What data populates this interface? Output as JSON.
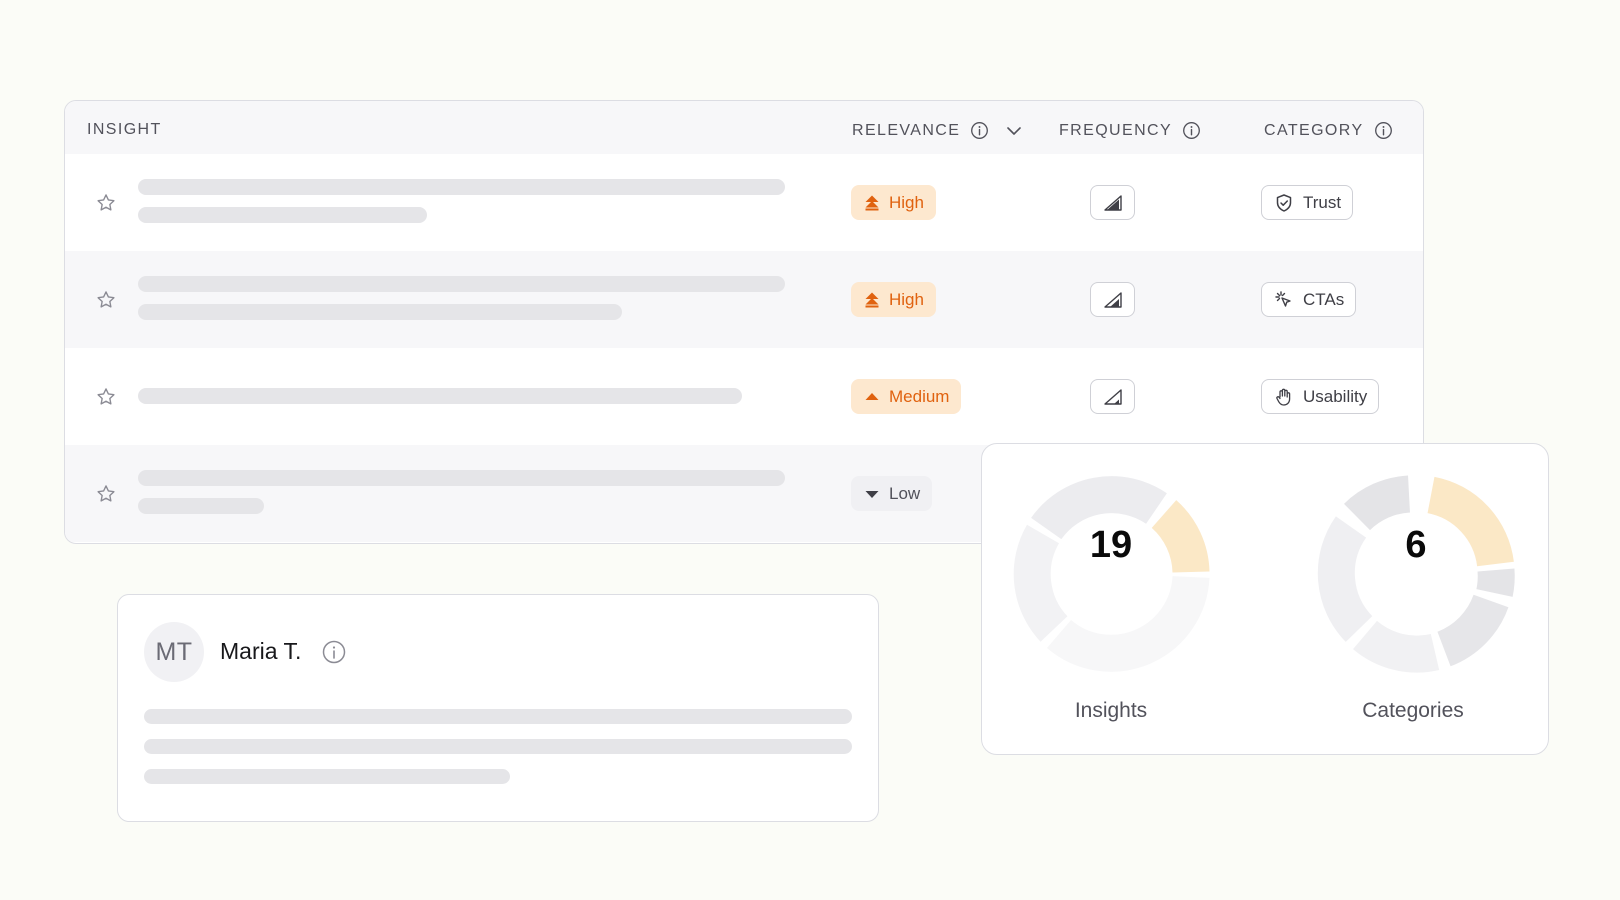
{
  "table": {
    "headers": {
      "insight": "INSIGHT",
      "relevance": "RELEVANCE",
      "frequency": "FREQUENCY",
      "category": "CATEGORY"
    },
    "rows": [
      {
        "relevance": "High",
        "relevance_level": "high",
        "frequency_level": 0.9,
        "category": "Trust",
        "category_icon": "shield-check-icon"
      },
      {
        "relevance": "High",
        "relevance_level": "high",
        "frequency_level": 0.75,
        "category": "CTAs",
        "category_icon": "click-icon"
      },
      {
        "relevance": "Medium",
        "relevance_level": "medium",
        "frequency_level": 0.5,
        "category": "Usability",
        "category_icon": "hand-icon"
      },
      {
        "relevance": "Low",
        "relevance_level": "low"
      }
    ]
  },
  "person": {
    "initials": "MT",
    "name": "Maria T."
  },
  "stats": {
    "insights": {
      "value": "19",
      "label": "Insights"
    },
    "categories": {
      "value": "6",
      "label": "Categories"
    }
  },
  "colors": {
    "accent_orange": "#e0620f",
    "badge_orange_bg": "#fde8cf",
    "donut_highlight": "#fbe8c6",
    "skeleton": "#e5e5e8"
  }
}
